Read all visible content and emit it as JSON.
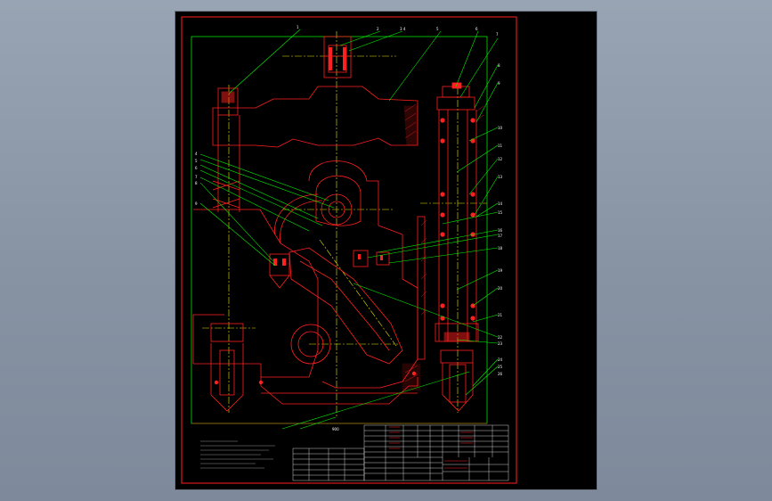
{
  "viewer": {
    "background": "#8793a3",
    "canvas_color": "#000000"
  },
  "drawing": {
    "line_colors": {
      "outline": "#ff2020",
      "leader": "#00ff00",
      "center": "#ffff00",
      "border": "#ff0000",
      "text": "#ffffff"
    },
    "dimension_label": "900",
    "callouts_top": [
      "1",
      "2",
      "3 4",
      "5",
      "6",
      "7"
    ],
    "callouts_left": [
      "4",
      "5",
      "6",
      "7",
      "8",
      "9"
    ],
    "callouts_right": [
      "8",
      "9",
      "10",
      "11",
      "12",
      "13",
      "14",
      "15",
      "16",
      "17",
      "18",
      "19",
      "20",
      "21",
      "22",
      "23",
      "24",
      "25",
      "26"
    ]
  }
}
